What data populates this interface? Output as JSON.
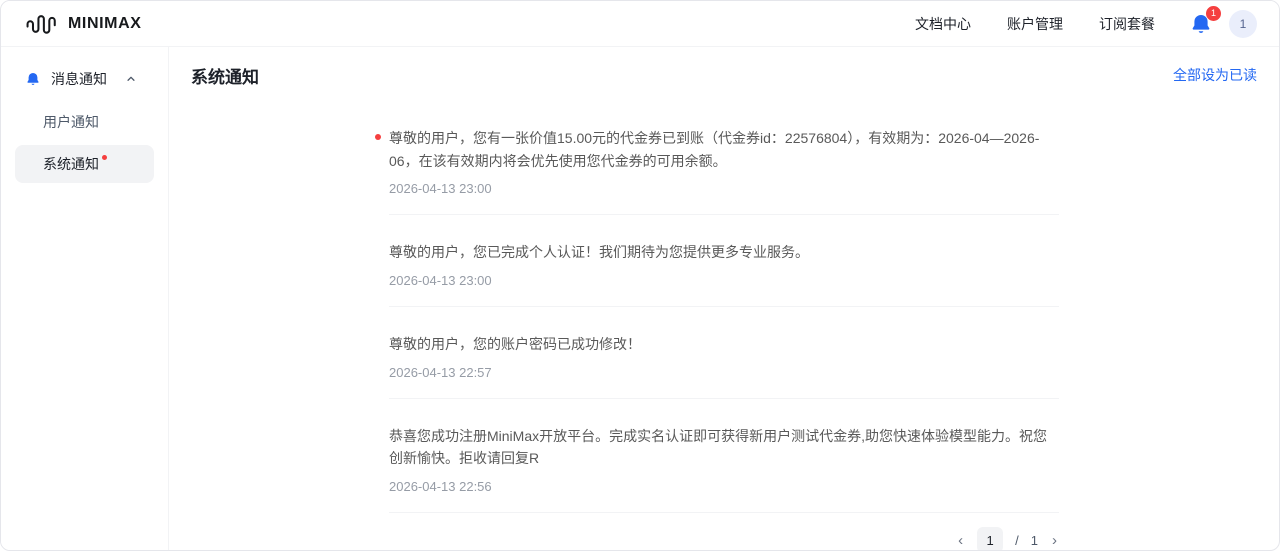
{
  "header": {
    "brand": "MINIMAX",
    "nav": [
      {
        "label": "文档中心"
      },
      {
        "label": "账户管理"
      },
      {
        "label": "订阅套餐"
      }
    ],
    "bell_badge": "1",
    "avatar_text": "1"
  },
  "sidebar": {
    "group_label": "消息通知",
    "items": [
      {
        "label": "用户通知",
        "active": false,
        "has_dot": false
      },
      {
        "label": "系统通知",
        "active": true,
        "has_dot": true
      }
    ]
  },
  "main": {
    "title": "系统通知",
    "mark_all_read": "全部设为已读",
    "notifications": [
      {
        "unread": true,
        "text": "尊敬的用户，您有一张价值15.00元的代金券已到账（代金券id：22576804），有效期为：2026-04—2026-06，在该有效期内将会优先使用您代金券的可用余额。",
        "time": "2026-04-13 23:00"
      },
      {
        "unread": false,
        "text": "尊敬的用户，您已完成个人认证！我们期待为您提供更多专业服务。",
        "time": "2026-04-13 23:00"
      },
      {
        "unread": false,
        "text": "尊敬的用户，您的账户密码已成功修改！",
        "time": "2026-04-13 22:57"
      },
      {
        "unread": false,
        "text": "恭喜您成功注册MiniMax开放平台。完成实名认证即可获得新用户测试代金券,助您快速体验模型能力。祝您创新愉快。拒收请回复R",
        "time": "2026-04-13 22:56"
      }
    ],
    "pagination": {
      "prev_icon": "‹",
      "current": "1",
      "separator": "/",
      "total": "1",
      "next_icon": "›"
    }
  },
  "colors": {
    "accent_blue": "#2468f2",
    "badge_red": "#f53f3f",
    "selected_bg": "#f2f3f5"
  }
}
